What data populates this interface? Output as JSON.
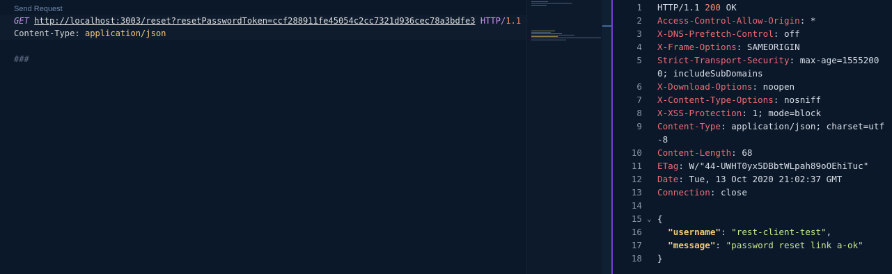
{
  "editor": {
    "codelens": "Send Request",
    "method": "GET",
    "url": "http://localhost:3003/reset?resetPasswordToken=ccf288911fe45054c2cc7321d936cec78a3bdfe3",
    "protocol": "HTTP",
    "slash": "/",
    "version": "1.1",
    "header_key": "Content-Type",
    "header_colon": ": ",
    "header_value": "application/json",
    "separator": "###"
  },
  "response": {
    "lines": [
      {
        "n": "1",
        "key": "HTTP/1.1 ",
        "status": "200",
        "rest": " OK"
      },
      {
        "n": "2",
        "key": "Access-Control-Allow-Origin",
        "rest": ": *"
      },
      {
        "n": "3",
        "key": "X-DNS-Prefetch-Control",
        "rest": ": off"
      },
      {
        "n": "4",
        "key": "X-Frame-Options",
        "rest": ": SAMEORIGIN"
      },
      {
        "n": "5",
        "key": "Strict-Transport-Security",
        "rest": ": max-age=15552000; includeSubDomains"
      },
      {
        "n": "6",
        "key": "X-Download-Options",
        "rest": ": noopen"
      },
      {
        "n": "7",
        "key": "X-Content-Type-Options",
        "rest": ": nosniff"
      },
      {
        "n": "8",
        "key": "X-XSS-Protection",
        "rest": ": 1; mode=block"
      },
      {
        "n": "9",
        "key": "Content-Type",
        "rest": ": application/json; charset=utf-8"
      },
      {
        "n": "10",
        "key": "Content-Length",
        "rest": ": 68"
      },
      {
        "n": "11",
        "key": "ETag",
        "rest": ": W/\"44-UWHT0yx5DBbtWLpah89oOEhiTuc\""
      },
      {
        "n": "12",
        "key": "Date",
        "rest": ": Tue, 13 Oct 2020 21:02:37 GMT"
      },
      {
        "n": "13",
        "key": "Connection",
        "rest": ": close"
      },
      {
        "n": "14",
        "key": "",
        "rest": ""
      },
      {
        "n": "15",
        "key": "",
        "rest": "{",
        "fold": "⌄"
      },
      {
        "n": "16",
        "jkey": "\"username\"",
        "jsep": ": ",
        "jval": "\"rest-client-test\"",
        "jend": ","
      },
      {
        "n": "17",
        "jkey": "\"message\"",
        "jsep": ": ",
        "jval": "\"password reset link a-ok\"",
        "jend": ""
      },
      {
        "n": "18",
        "key": "",
        "rest": "}"
      }
    ]
  },
  "colors": {
    "background": "#0b1829",
    "header_key": "#ef6b73",
    "json_key": "#f2ca73",
    "json_string": "#c3e88d",
    "divider": "#7b3fd1"
  }
}
